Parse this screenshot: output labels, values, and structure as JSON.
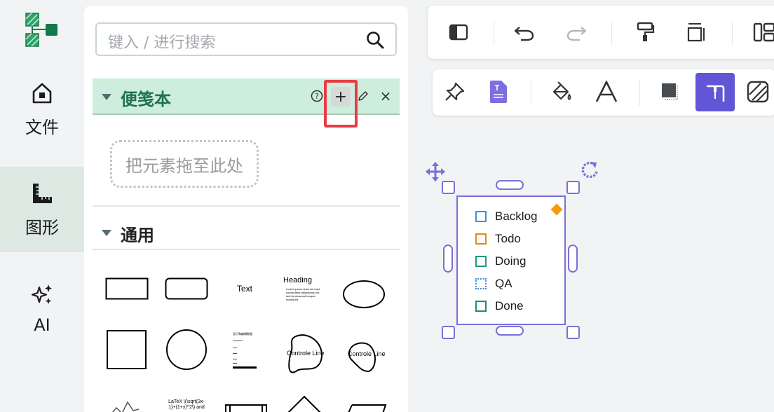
{
  "rail": {
    "items": [
      {
        "label": "文件",
        "icon": "home-icon"
      },
      {
        "label": "图形",
        "icon": "ruler-icon",
        "active": true
      },
      {
        "label": "AI",
        "icon": "sparkles-icon"
      }
    ]
  },
  "panel": {
    "search": {
      "placeholder": "键入 / 进行搜索",
      "icon": "search-icon"
    },
    "scratchpad": {
      "title": "便笺本",
      "actions": [
        "help-icon",
        "add-icon",
        "edit-icon",
        "close-icon"
      ],
      "add_label": "+",
      "close_label": "×",
      "help_label": "?",
      "drop_hint": "把元素拖至此处"
    },
    "general": {
      "title": "通用",
      "shape_texts": {
        "text": "Text",
        "heading": "Heading",
        "heading_body": "Lorem ipsum dolor sit amet, consectetur adipisicing elit, sed do eiusmod tempor incididunt",
        "list_title": "显示和编辑数据",
        "controle_line_1": "Controle Line",
        "controle_line_2": "Controle Line",
        "latex": "LaTeX \\(\\sqrt{3x-1}+(1+x)^2\\) and",
        "latex_2": "$\\sqrt{3x-1}+(1+x)^2$"
      }
    }
  },
  "toolbar_top": {
    "buttons": [
      "sidebar-toggle-icon",
      "undo-icon",
      "redo-icon",
      "format-painter-icon",
      "resize-icon",
      "layout-icon"
    ]
  },
  "toolbar_format": {
    "buttons": [
      "pin-icon",
      "text-document-icon",
      "fill-bucket-icon",
      "font-icon",
      "shadow-icon",
      "connector-style-icon",
      "pattern-icon"
    ],
    "colors": {
      "accent": "#6156d6",
      "doc": "#7d6fe0"
    }
  },
  "canvas": {
    "tasks": [
      {
        "label": "Backlog",
        "color": "#3f8fe0"
      },
      {
        "label": "Todo",
        "color": "#dd8a1b"
      },
      {
        "label": "Doing",
        "color": "#1f9a7c"
      },
      {
        "label": "QA",
        "color": "#3f8fe0"
      },
      {
        "label": "Done",
        "color": "#1c8c70"
      }
    ],
    "selection_color": "#7b6fd8",
    "diamond_color": "#f29a12"
  }
}
